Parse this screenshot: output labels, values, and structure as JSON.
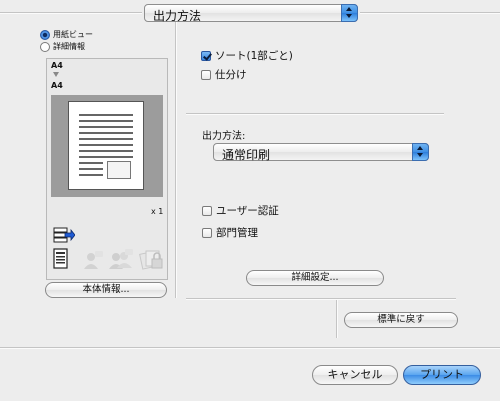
{
  "header": {
    "output_popup": "出力方法"
  },
  "preview": {
    "radio_paper_view": "用紙ビュー",
    "radio_detail_info": "詳細情報",
    "paper_from": "A4",
    "paper_to": "A4",
    "copies": "x 1",
    "device_info_button": "本体情報..."
  },
  "options": {
    "sort_label": "ソート(1部ごと)",
    "sort_checked": true,
    "offset_label": "仕分け",
    "offset_checked": false,
    "output_method_label": "出力方法:",
    "output_method_value": "通常印刷",
    "user_auth_label": "ユーザー認証",
    "user_auth_checked": false,
    "account_track_label": "部門管理",
    "account_track_checked": false,
    "detail_settings_button": "詳細設定..."
  },
  "footer": {
    "restore_defaults_button": "標準に戻す",
    "cancel_button": "キャンセル",
    "print_button": "プリント"
  },
  "colors": {
    "accent_blue": "#3c8ce6",
    "background": "#ededed"
  }
}
